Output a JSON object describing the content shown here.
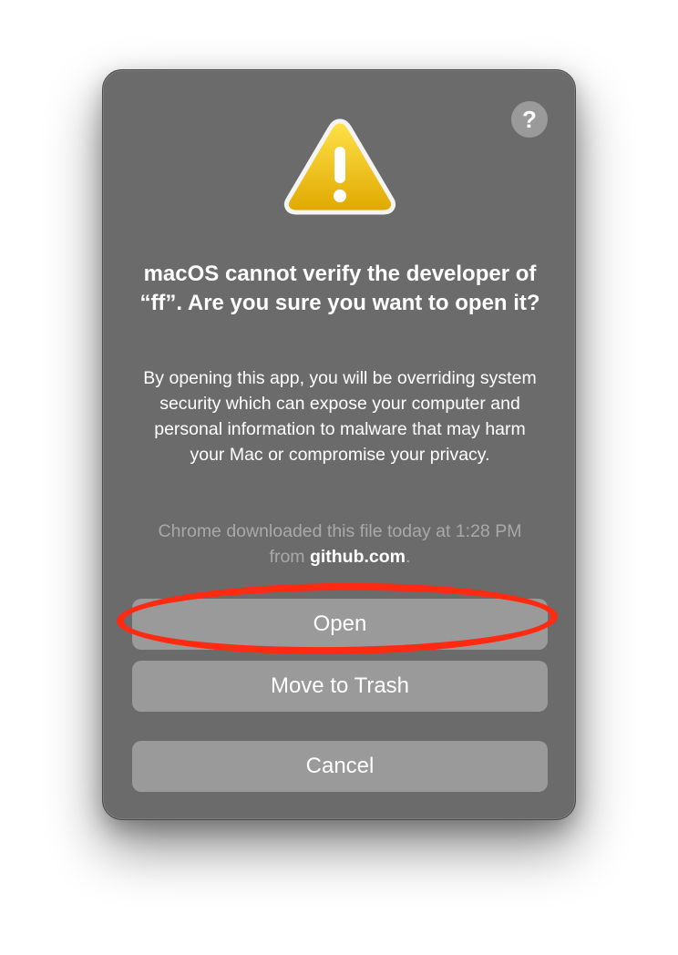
{
  "dialog": {
    "help_label": "?",
    "icon": "warning-triangle-icon",
    "title": "macOS cannot verify the developer of “ff”. Are you sure you want to open it?",
    "body": "By opening this app, you will be overriding system security which can expose your computer and personal information to malware that may harm your Mac or compromise your privacy.",
    "source_note_prefix": "Chrome downloaded this file today at 1:28 PM from ",
    "source_domain": "github.com",
    "source_note_suffix": "."
  },
  "buttons": {
    "open_label": "Open",
    "trash_label": "Move to Trash",
    "cancel_label": "Cancel"
  },
  "annotation": {
    "type": "red-ellipse-highlight",
    "target": "open-button",
    "color": "#ff2a12"
  },
  "colors": {
    "dialog_background": "#6b6b6b",
    "button_background": "#9a9a9a",
    "warning_yellow": "#f2c200",
    "text_primary": "#ffffff",
    "text_secondary": "#a9a9a9"
  }
}
